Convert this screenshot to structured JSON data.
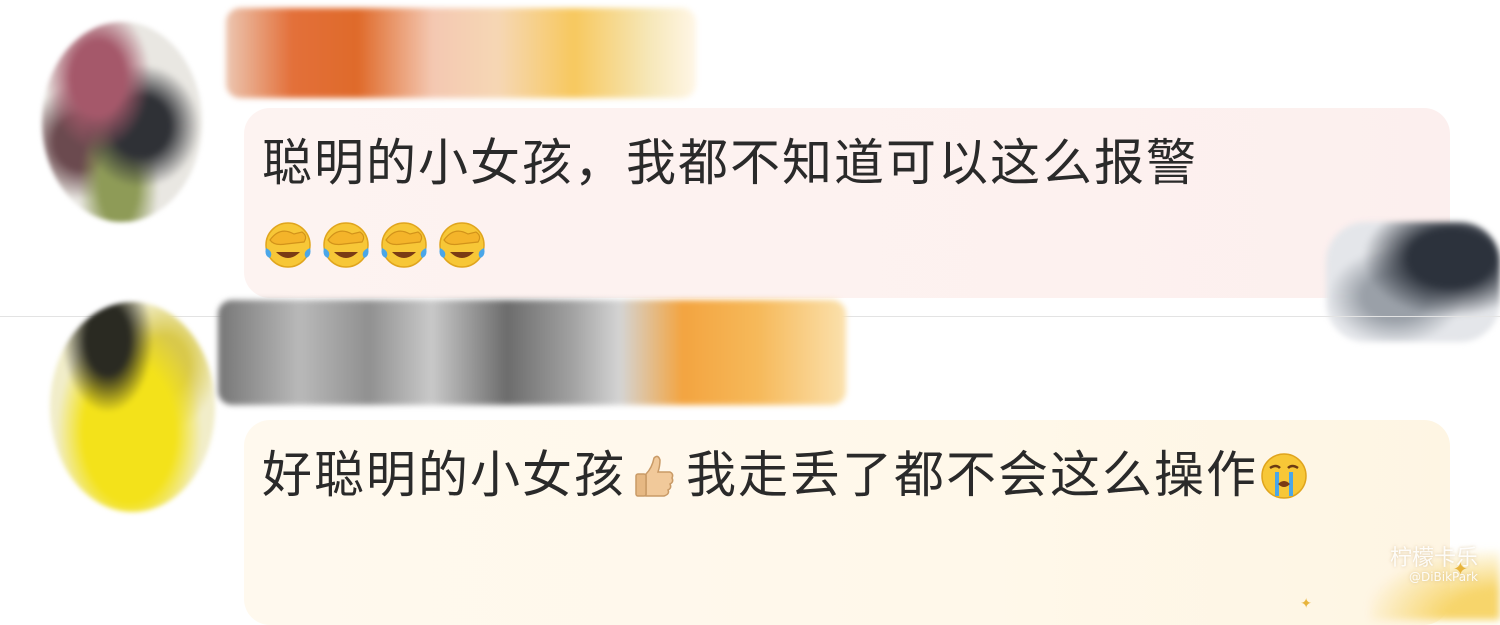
{
  "comments": [
    {
      "text": "聪明的小女孩，我都不知道可以这么报警",
      "emojis": [
        "facepalm-laugh-icon",
        "facepalm-laugh-icon",
        "facepalm-laugh-icon",
        "facepalm-laugh-icon"
      ],
      "bubble_color": "#fdf1ef"
    },
    {
      "text_before_emoji": "好聪明的小女孩",
      "inline_emoji": "thumbs-up-icon",
      "text_after_emoji": "我走丢了都不会这么操作",
      "trailing_emoji": "crying-face-icon",
      "bubble_color": "#fff8ea"
    }
  ],
  "watermark": {
    "main": "柠檬卡乐",
    "sub": "@DiBikPark"
  }
}
